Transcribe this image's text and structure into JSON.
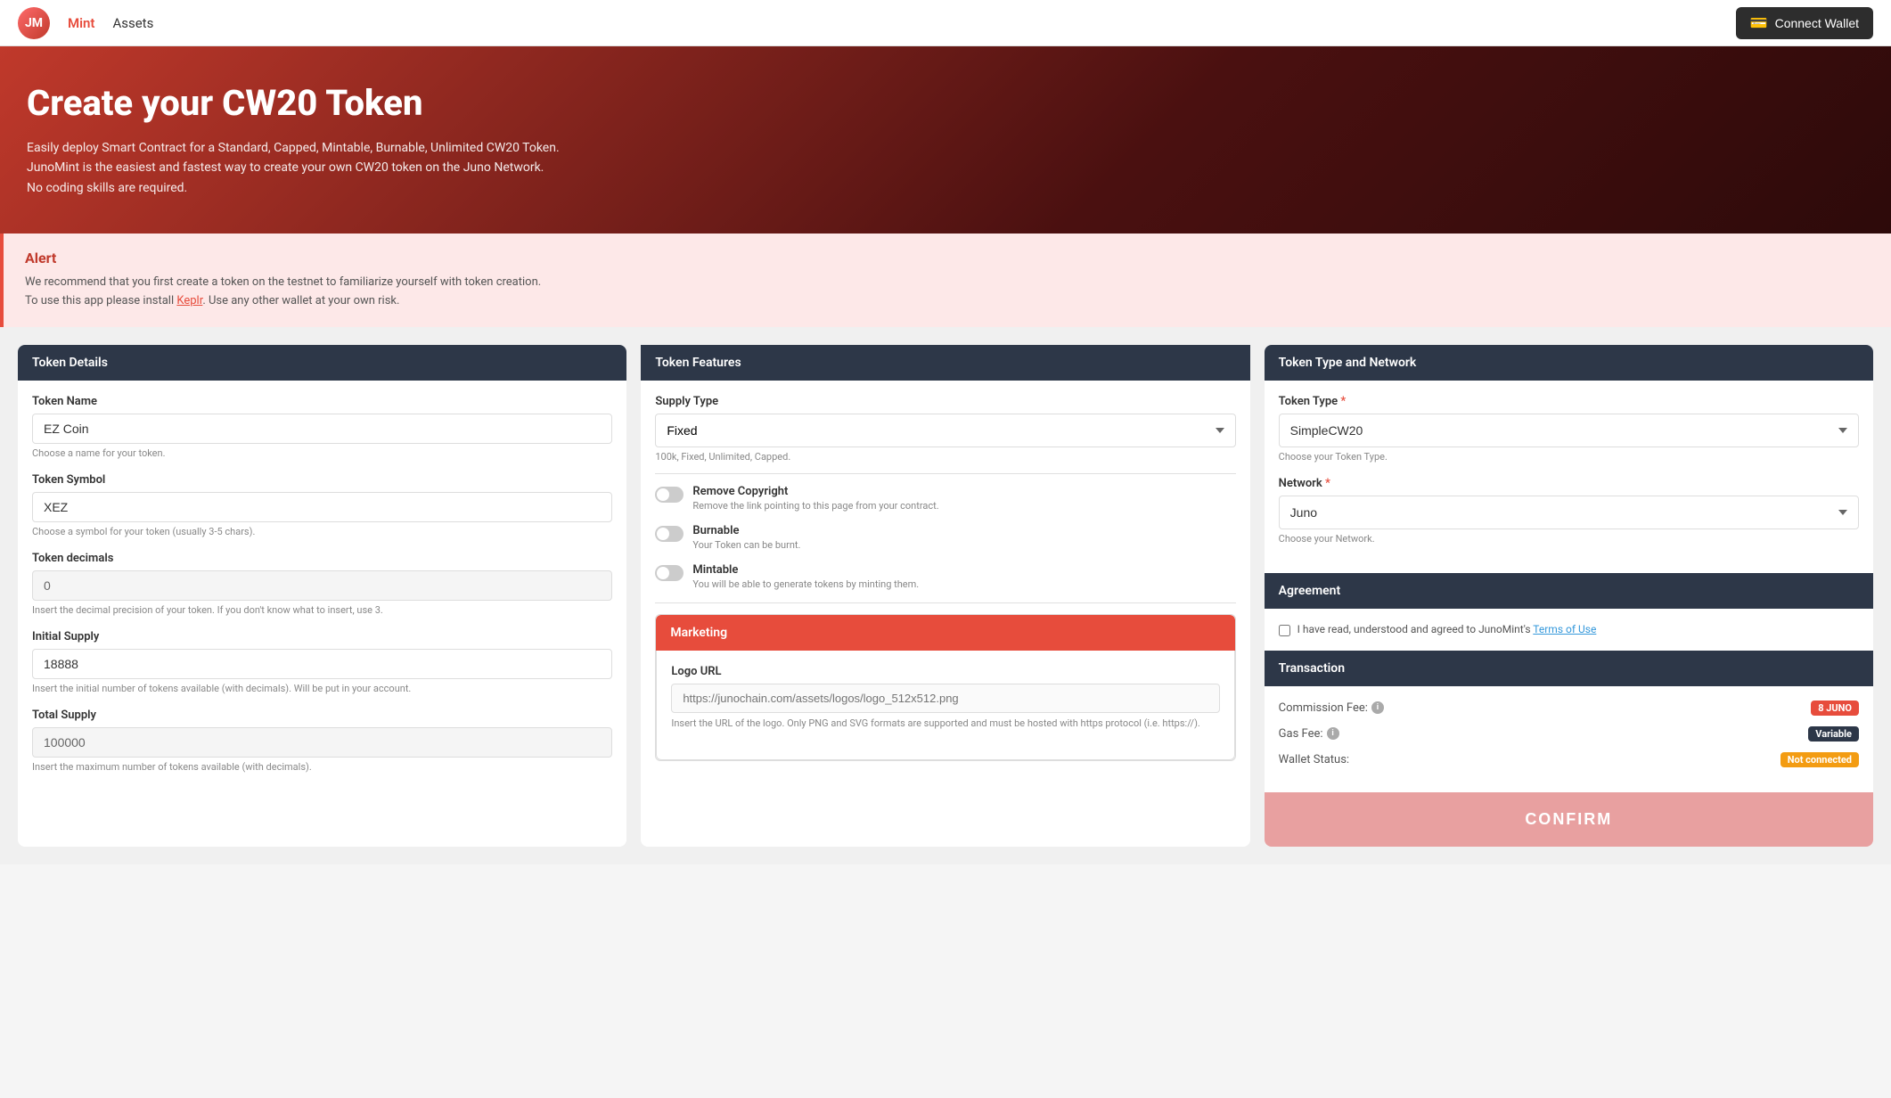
{
  "navbar": {
    "logo_text": "JM",
    "nav_items": [
      {
        "label": "Mint",
        "active": true
      },
      {
        "label": "Assets",
        "active": false
      }
    ],
    "connect_wallet_label": "Connect Wallet"
  },
  "hero": {
    "title": "Create your CW20 Token",
    "description_lines": [
      "Easily deploy Smart Contract for a Standard, Capped, Mintable, Burnable, Unlimited CW20 Token.",
      "JunoMint is the easiest and fastest way to create your own CW20 token on the Juno Network.",
      "No coding skills are required."
    ]
  },
  "alert": {
    "title": "Alert",
    "text1": "We recommend that you first create a token on the testnet to familiarize yourself with token creation.",
    "text2_before": "To use this app please install ",
    "text2_link": "Keplr",
    "text2_after": ". Use any other wallet at your own risk."
  },
  "token_details": {
    "header": "Token Details",
    "token_name_label": "Token Name",
    "token_name_value": "EZ Coin",
    "token_name_hint": "Choose a name for your token.",
    "token_symbol_label": "Token Symbol",
    "token_symbol_value": "XEZ",
    "token_symbol_hint": "Choose a symbol for your token (usually 3-5 chars).",
    "token_decimals_label": "Token decimals",
    "token_decimals_value": "0",
    "token_decimals_hint": "Insert the decimal precision of your token. If you don't know what to insert, use 3.",
    "initial_supply_label": "Initial Supply",
    "initial_supply_value": "18888",
    "initial_supply_hint": "Insert the initial number of tokens available (with decimals). Will be put in your account.",
    "total_supply_label": "Total Supply",
    "total_supply_value": "100000",
    "total_supply_hint": "Insert the maximum number of tokens available (with decimals)."
  },
  "token_features": {
    "header": "Token Features",
    "supply_type_label": "Supply Type",
    "supply_type_value": "Fixed",
    "supply_type_options": [
      "Fixed",
      "100k",
      "Unlimited",
      "Capped"
    ],
    "supply_hint": "100k, Fixed, Unlimited, Capped.",
    "remove_copyright_label": "Remove Copyright",
    "remove_copyright_desc": "Remove the link pointing to this page from your contract.",
    "remove_copyright_on": false,
    "burnable_label": "Burnable",
    "burnable_desc": "Your Token can be burnt.",
    "burnable_on": false,
    "mintable_label": "Mintable",
    "mintable_desc": "You will be able to generate tokens by minting them.",
    "mintable_on": false,
    "marketing_header": "Marketing",
    "logo_url_label": "Logo URL",
    "logo_url_placeholder": "https://junochain.com/assets/logos/logo_512x512.png",
    "logo_url_hint": "Insert the URL of the logo. Only PNG and SVG formats are supported and must be hosted with https protocol (i.e. https://)."
  },
  "token_type_network": {
    "header": "Token Type and Network",
    "token_type_label": "Token Type",
    "token_type_required": true,
    "token_type_value": "SimpleCW20",
    "token_type_options": [
      "SimpleCW20"
    ],
    "token_type_hint": "Choose your Token Type.",
    "network_label": "Network",
    "network_required": true,
    "network_value": "Juno",
    "network_options": [
      "Juno"
    ],
    "network_hint": "Choose your Network.",
    "agreement_header": "Agreement",
    "agreement_text": "I have read, understood and agreed to JunoMint's ",
    "agreement_link": "Terms of Use",
    "agreement_checked": false,
    "transaction_header": "Transaction",
    "commission_fee_label": "Commission Fee:",
    "commission_fee_badge": "8 JUNO",
    "gas_fee_label": "Gas Fee:",
    "gas_fee_badge": "Variable",
    "wallet_status_label": "Wallet Status:",
    "wallet_status_badge": "Not connected",
    "confirm_label": "CONFIRM"
  }
}
